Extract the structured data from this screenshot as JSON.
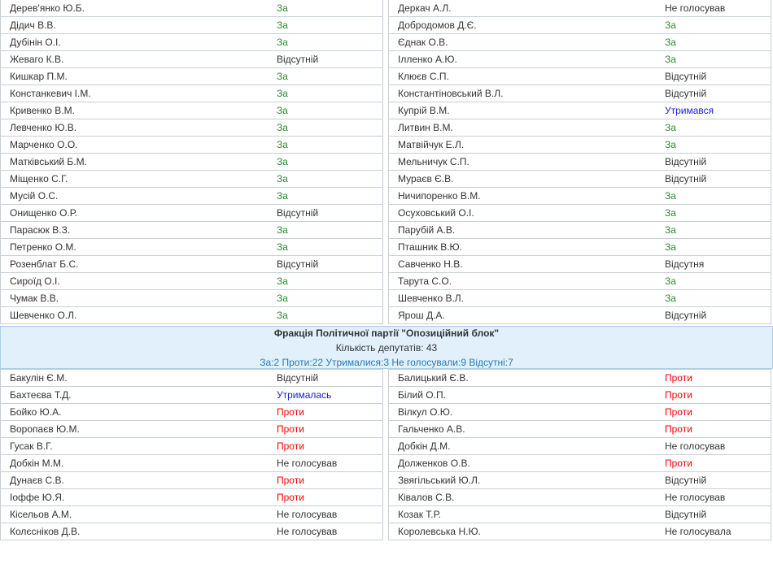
{
  "top_rows": [
    [
      {
        "name": "Дерев'янко Ю.Б.",
        "vote": "За",
        "t": "za"
      },
      {
        "name": "Деркач А.Л.",
        "vote": "Не голосував",
        "t": "other"
      }
    ],
    [
      {
        "name": "Дідич В.В.",
        "vote": "За",
        "t": "za"
      },
      {
        "name": "Добродомов Д.Є.",
        "vote": "За",
        "t": "za"
      }
    ],
    [
      {
        "name": "Дубінін О.І.",
        "vote": "За",
        "t": "za"
      },
      {
        "name": "Єднак О.В.",
        "vote": "За",
        "t": "za"
      }
    ],
    [
      {
        "name": "Жеваго К.В.",
        "vote": "Відсутній",
        "t": "other"
      },
      {
        "name": "Ілленко А.Ю.",
        "vote": "За",
        "t": "za"
      }
    ],
    [
      {
        "name": "Кишкар П.М.",
        "vote": "За",
        "t": "za"
      },
      {
        "name": "Клюєв С.П.",
        "vote": "Відсутній",
        "t": "other"
      }
    ],
    [
      {
        "name": "Констанкевич І.М.",
        "vote": "За",
        "t": "za"
      },
      {
        "name": "Константіновський В.Л.",
        "vote": "Відсутній",
        "t": "other"
      }
    ],
    [
      {
        "name": "Кривенко В.М.",
        "vote": "За",
        "t": "za"
      },
      {
        "name": "Купрій В.М.",
        "vote": "Утримався",
        "t": "utr"
      }
    ],
    [
      {
        "name": "Левченко Ю.В.",
        "vote": "За",
        "t": "za"
      },
      {
        "name": "Литвин В.М.",
        "vote": "За",
        "t": "za"
      }
    ],
    [
      {
        "name": "Марченко О.О.",
        "vote": "За",
        "t": "za"
      },
      {
        "name": "Матвійчук Е.Л.",
        "vote": "За",
        "t": "za"
      }
    ],
    [
      {
        "name": "Матківський Б.М.",
        "vote": "За",
        "t": "za"
      },
      {
        "name": "Мельничук С.П.",
        "vote": "Відсутній",
        "t": "other"
      }
    ],
    [
      {
        "name": "Міщенко С.Г.",
        "vote": "За",
        "t": "za"
      },
      {
        "name": "Мураєв Є.В.",
        "vote": "Відсутній",
        "t": "other"
      }
    ],
    [
      {
        "name": "Мусій О.С.",
        "vote": "За",
        "t": "za"
      },
      {
        "name": "Ничипоренко В.М.",
        "vote": "За",
        "t": "za"
      }
    ],
    [
      {
        "name": "Онищенко О.Р.",
        "vote": "Відсутній",
        "t": "other"
      },
      {
        "name": "Осуховський О.І.",
        "vote": "За",
        "t": "za"
      }
    ],
    [
      {
        "name": "Парасюк В.З.",
        "vote": "За",
        "t": "za"
      },
      {
        "name": "Парубій А.В.",
        "vote": "За",
        "t": "za"
      }
    ],
    [
      {
        "name": "Петренко О.М.",
        "vote": "За",
        "t": "za"
      },
      {
        "name": "Пташник В.Ю.",
        "vote": "За",
        "t": "za"
      }
    ],
    [
      {
        "name": "Розенблат Б.С.",
        "vote": "Відсутній",
        "t": "other"
      },
      {
        "name": "Савченко Н.В.",
        "vote": "Відсутня",
        "t": "other"
      }
    ],
    [
      {
        "name": "Сироїд О.І.",
        "vote": "За",
        "t": "za"
      },
      {
        "name": "Тарута С.О.",
        "vote": "За",
        "t": "za"
      }
    ],
    [
      {
        "name": "Чумак В.В.",
        "vote": "За",
        "t": "za"
      },
      {
        "name": "Шевченко В.Л.",
        "vote": "За",
        "t": "za"
      }
    ],
    [
      {
        "name": "Шевченко О.Л.",
        "vote": "За",
        "t": "za"
      },
      {
        "name": "Ярош Д.А.",
        "vote": "Відсутній",
        "t": "other"
      }
    ]
  ],
  "faction": {
    "title": "Фракція Політичної партії \"Опозиційний блок\"",
    "count": "Кількість депутатів: 43",
    "stats": "За:2 Проти:22 Утрималися:3 Не голосували:9 Відсутні:7"
  },
  "bottom_rows": [
    [
      {
        "name": "Бакулін Є.М.",
        "vote": "Відсутній",
        "t": "other"
      },
      {
        "name": "Балицький Є.В.",
        "vote": "Проти",
        "t": "proty"
      }
    ],
    [
      {
        "name": "Бахтеєва Т.Д.",
        "vote": "Утрималась",
        "t": "utr"
      },
      {
        "name": "Білий О.П.",
        "vote": "Проти",
        "t": "proty"
      }
    ],
    [
      {
        "name": "Бойко Ю.А.",
        "vote": "Проти",
        "t": "proty"
      },
      {
        "name": "Вілкул О.Ю.",
        "vote": "Проти",
        "t": "proty"
      }
    ],
    [
      {
        "name": "Воропаєв Ю.М.",
        "vote": "Проти",
        "t": "proty"
      },
      {
        "name": "Гальченко А.В.",
        "vote": "Проти",
        "t": "proty"
      }
    ],
    [
      {
        "name": "Гусак В.Г.",
        "vote": "Проти",
        "t": "proty"
      },
      {
        "name": "Добкін Д.М.",
        "vote": "Не голосував",
        "t": "other"
      }
    ],
    [
      {
        "name": "Добкін М.М.",
        "vote": "Не голосував",
        "t": "other"
      },
      {
        "name": "Долженков О.В.",
        "vote": "Проти",
        "t": "proty"
      }
    ],
    [
      {
        "name": "Дунаєв С.В.",
        "vote": "Проти",
        "t": "proty"
      },
      {
        "name": "Звягільський Ю.Л.",
        "vote": "Відсутній",
        "t": "other"
      }
    ],
    [
      {
        "name": "Іоффе Ю.Я.",
        "vote": "Проти",
        "t": "proty"
      },
      {
        "name": "Ківалов С.В.",
        "vote": "Не голосував",
        "t": "other"
      }
    ],
    [
      {
        "name": "Кісельов А.М.",
        "vote": "Не голосував",
        "t": "other"
      },
      {
        "name": "Козак Т.Р.",
        "vote": "Відсутній",
        "t": "other"
      }
    ],
    [
      {
        "name": "Колєсніков Д.В.",
        "vote": "Не голосував",
        "t": "other"
      },
      {
        "name": "Королевська Н.Ю.",
        "vote": "Не голосувала",
        "t": "other"
      }
    ]
  ]
}
